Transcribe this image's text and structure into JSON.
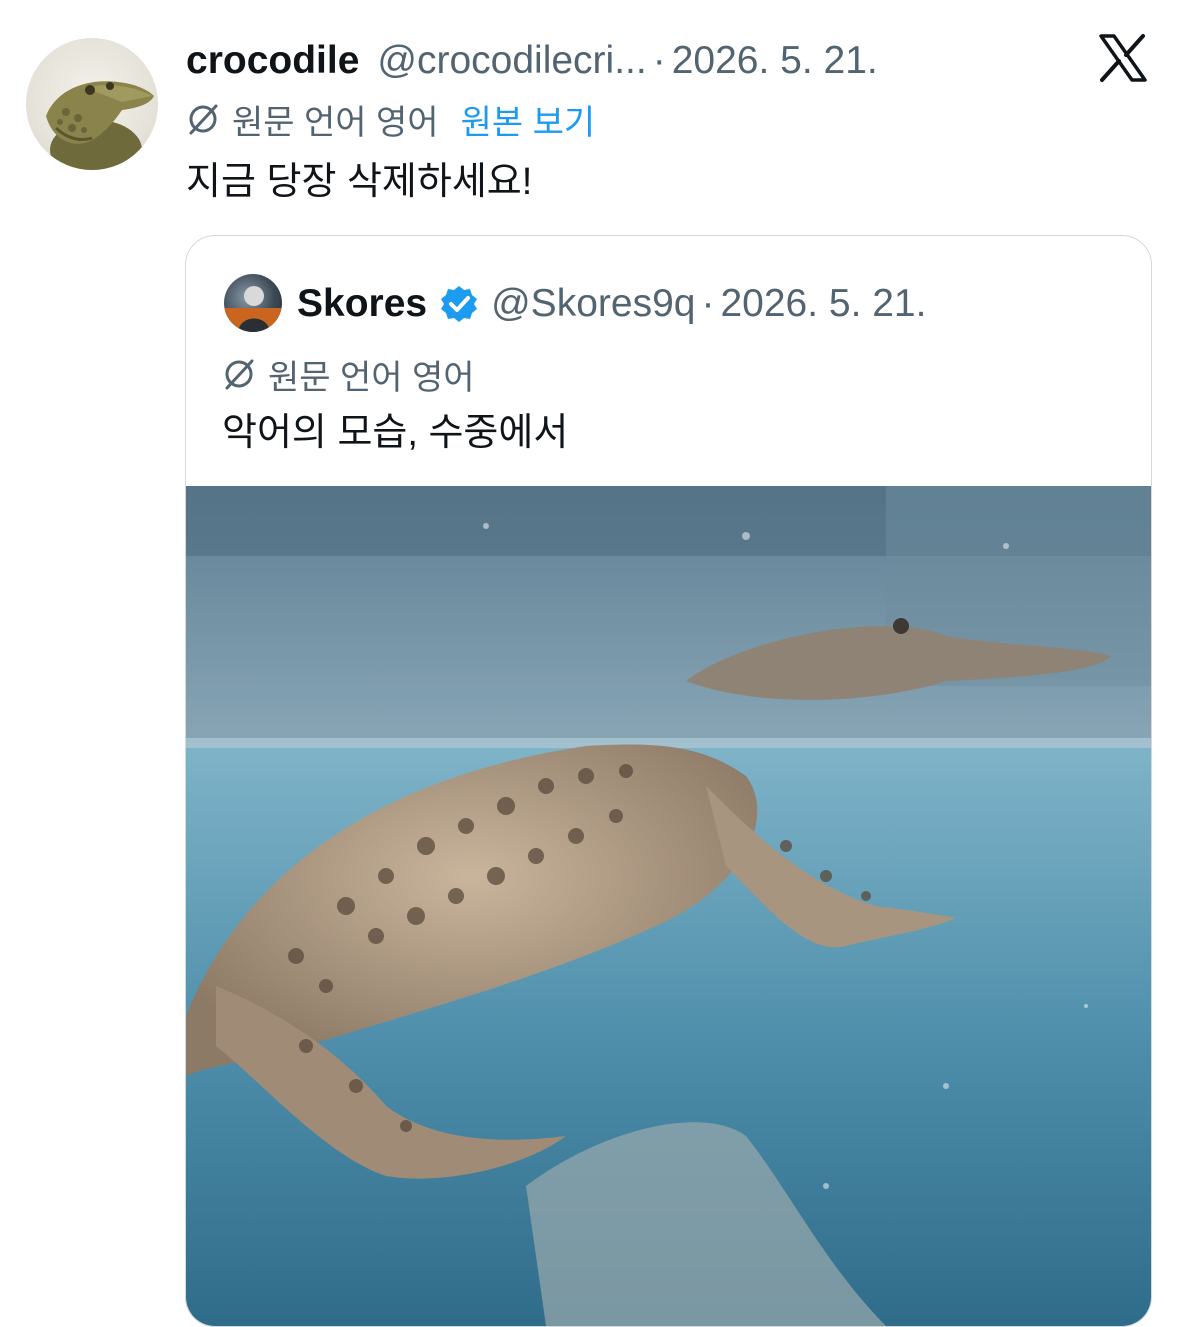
{
  "tweet": {
    "author_name": "crocodile",
    "handle": "@crocodilecri...",
    "separator": "·",
    "date": "2026. 5. 21.",
    "translation_note": "원문 언어 영어",
    "show_original": "원본 보기",
    "text": "지금 당장 삭제하세요!"
  },
  "quoted": {
    "author_name": "Skores",
    "handle": "@Skores9q",
    "separator": "·",
    "date": "2026. 5. 21.",
    "translation_note": "원문 언어 영어",
    "text": "악어의 모습, 수중에서"
  },
  "icons": {
    "brand": "x-logo-icon",
    "translate": "translate-icon",
    "verified": "verified-badge-icon"
  },
  "colors": {
    "accent": "#1d9bf0",
    "secondary_text": "#536471",
    "primary_text": "#0f1419",
    "border": "#cfd9de"
  }
}
